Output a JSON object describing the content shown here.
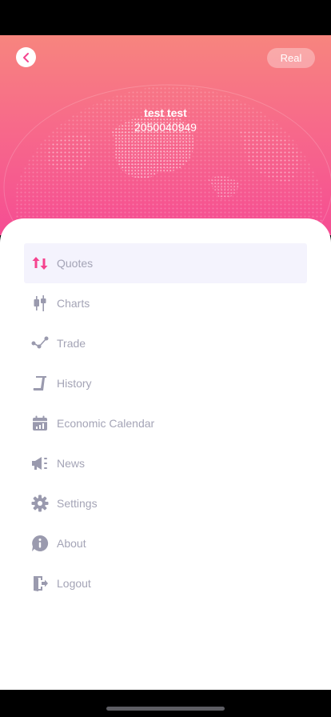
{
  "header": {
    "account_type": "Real",
    "user_name": "test test",
    "user_id": "2050040949"
  },
  "menu": {
    "items": [
      {
        "label": "Quotes",
        "icon": "quotes-icon",
        "active": true
      },
      {
        "label": "Charts",
        "icon": "charts-icon"
      },
      {
        "label": "Trade",
        "icon": "trade-icon"
      },
      {
        "label": "History",
        "icon": "history-icon"
      },
      {
        "label": "Economic Calendar",
        "icon": "calendar-icon"
      },
      {
        "label": "News",
        "icon": "news-icon"
      },
      {
        "label": "Settings",
        "icon": "settings-icon"
      },
      {
        "label": "About",
        "icon": "about-icon"
      },
      {
        "label": "Logout",
        "icon": "logout-icon"
      }
    ]
  },
  "colors": {
    "accent": "#f5448f",
    "gradient_top": "#f7857e",
    "gradient_bottom": "#f54d93",
    "icon_gray": "#9a9aae",
    "label_gray": "#a4a4b6",
    "active_bg": "#f4f3fd"
  }
}
